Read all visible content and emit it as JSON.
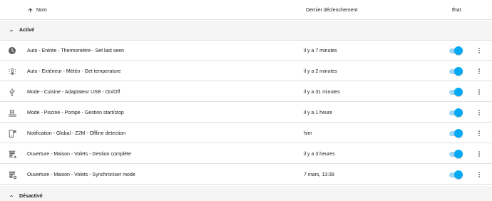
{
  "header": {
    "name_label": "Nom",
    "last_triggered_label": "Dernier déclenchement",
    "state_label": "État"
  },
  "groups": {
    "active_label": "Activé",
    "inactive_label": "Désactivé"
  },
  "colors": {
    "accent": "#03a9f4",
    "accent_track": "#9ed6f5",
    "icon": "#616161",
    "group_bg": "#f5f5f5",
    "divider": "#e0e0e0"
  },
  "rows": [
    {
      "icon": "clock-icon",
      "name": "Auto - Entrée - Thermomètre - Set last seen",
      "last_triggered": "il y a 7 minutes",
      "enabled": true
    },
    {
      "icon": "thermometer-sun-icon",
      "name": "Auto - Extérieur - Météo - Get temperature",
      "last_triggered": "il y a 2 minutes",
      "enabled": true
    },
    {
      "icon": "usb-icon",
      "name": "Mode - Cuisine - Adaptateur USB - On/Off",
      "last_triggered": "il y a 31 minutes",
      "enabled": true
    },
    {
      "icon": "pool-icon",
      "name": "Mode - Piscine - Pompe - Gestion start/stop",
      "last_triggered": "il y a 1 heure",
      "enabled": true
    },
    {
      "icon": "cellphone-message-icon",
      "name": "Notification - Global - Z2M - Offline detection",
      "last_triggered": "hier",
      "enabled": true
    },
    {
      "icon": "window-shutter-auto-icon",
      "name": "Ouverture - Maison - Volets - Gestion complète",
      "last_triggered": "il y a 3 heures",
      "enabled": true
    },
    {
      "icon": "window-shutter-cog-icon",
      "name": "Ouverture - Maison - Volets - Synchroniser mode",
      "last_triggered": "7 mars, 13:39",
      "enabled": true
    }
  ]
}
